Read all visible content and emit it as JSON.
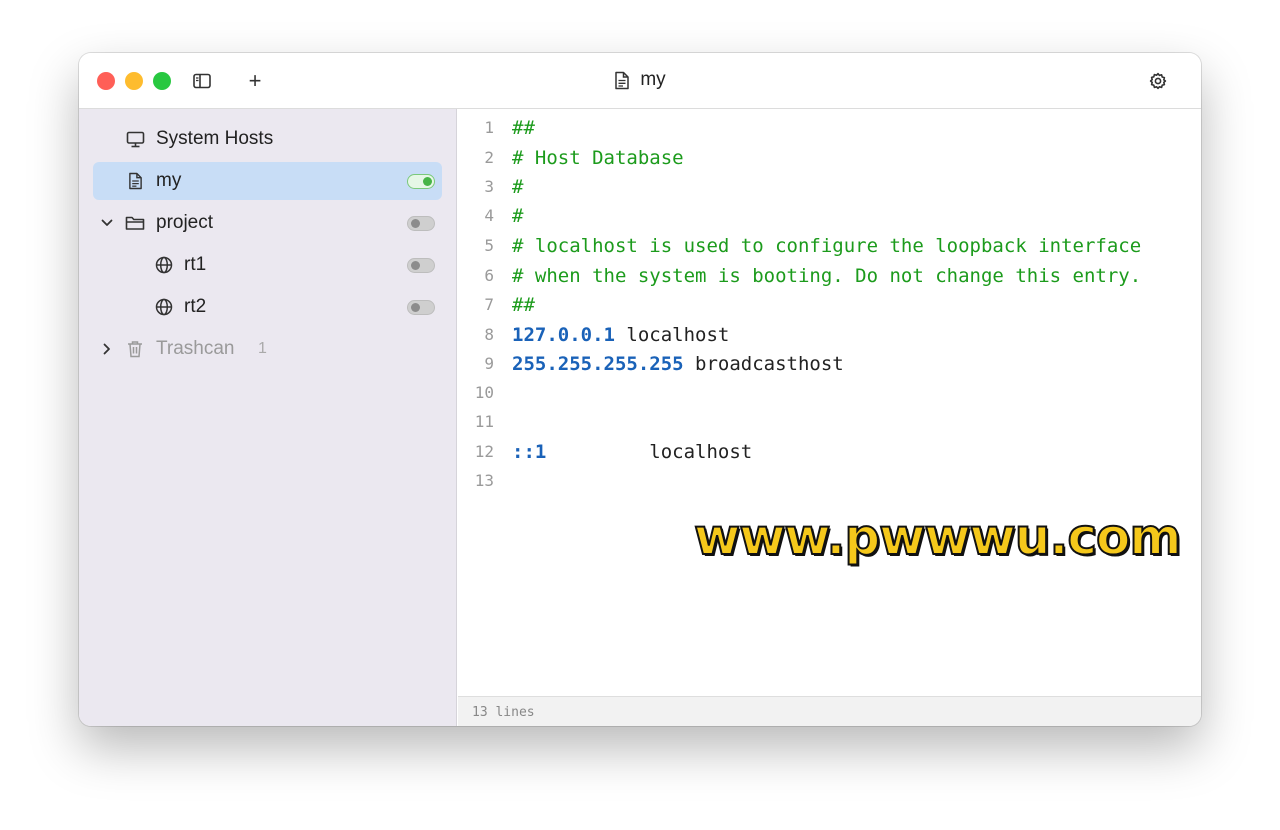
{
  "window": {
    "title": "my",
    "title_icon": "document-icon"
  },
  "toolbar": {
    "sidebar_toggle_icon": "sidebar-icon",
    "add_label": "+",
    "settings_icon": "gear-icon"
  },
  "sidebar": {
    "items": [
      {
        "label": "System Hosts",
        "icon": "monitor-icon"
      },
      {
        "label": "my",
        "icon": "document-icon",
        "enabled": true,
        "selected": true
      },
      {
        "label": "project",
        "icon": "folder-icon",
        "enabled": false,
        "expanded": true
      },
      {
        "label": "rt1",
        "icon": "globe-icon",
        "enabled": false
      },
      {
        "label": "rt2",
        "icon": "globe-icon",
        "enabled": false
      },
      {
        "label": "Trashcan",
        "icon": "trash-icon",
        "count": "1",
        "expanded": false
      }
    ]
  },
  "editor": {
    "lines": [
      {
        "num": "1",
        "text": "##",
        "kind": "comment"
      },
      {
        "num": "2",
        "text": "# Host Database",
        "kind": "comment"
      },
      {
        "num": "3",
        "text": "#",
        "kind": "comment"
      },
      {
        "num": "4",
        "text": "#",
        "kind": "comment"
      },
      {
        "num": "5",
        "text": "# localhost is used to configure the loopback interface",
        "kind": "comment"
      },
      {
        "num": "6",
        "text": "# when the system is booting. Do not change this entry.",
        "kind": "comment"
      },
      {
        "num": "7",
        "text": "##",
        "kind": "comment"
      },
      {
        "num": "8",
        "ip": "127.0.0.1",
        "host": " localhost",
        "kind": "entry"
      },
      {
        "num": "9",
        "ip": "255.255.255.255",
        "host": " broadcasthost",
        "kind": "entry"
      },
      {
        "num": "10",
        "text": "",
        "kind": "blank"
      },
      {
        "num": "11",
        "text": "",
        "kind": "blank"
      },
      {
        "num": "12",
        "ip": "::1",
        "host": "         localhost",
        "kind": "entry"
      },
      {
        "num": "13",
        "text": "",
        "kind": "blank"
      }
    ]
  },
  "status": {
    "lines_label": "13 lines"
  },
  "watermark": "www.pwwwu.com",
  "colors": {
    "comment": "#1c9b1c",
    "ip": "#1a62b8",
    "selected_bg": "#c8ddf6",
    "toggle_on": "#47b447"
  }
}
